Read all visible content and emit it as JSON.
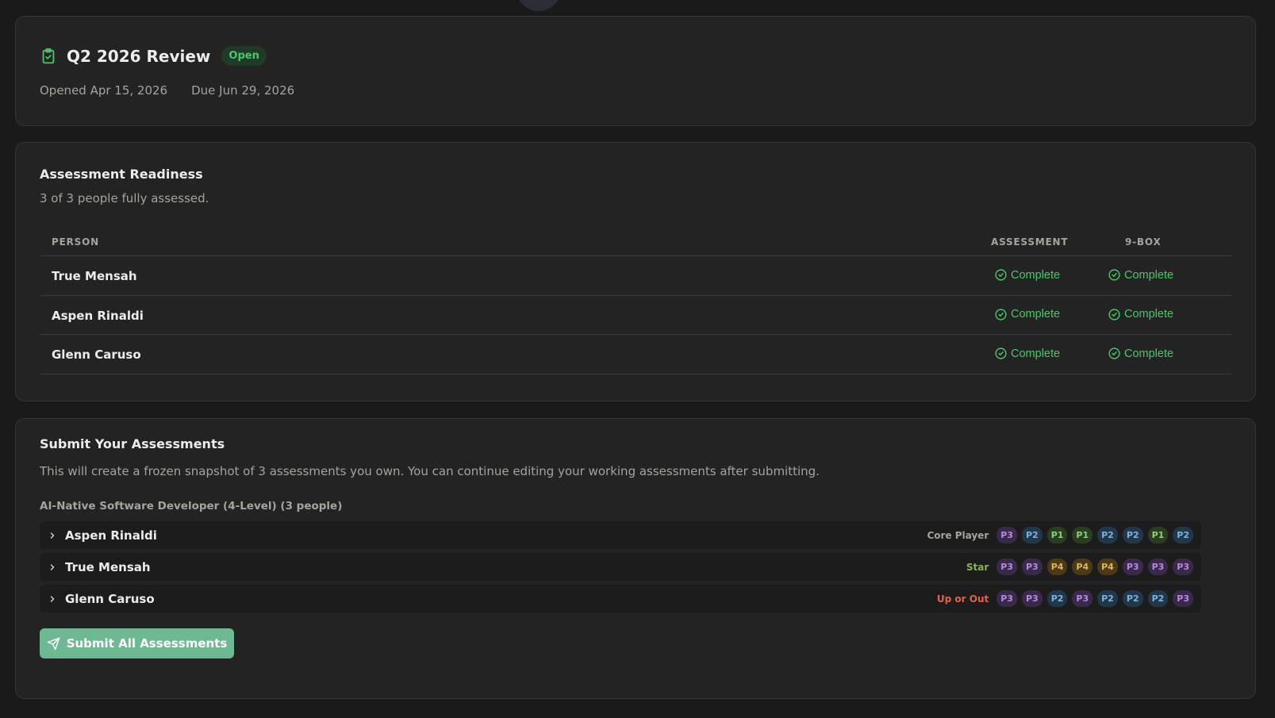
{
  "colors": {
    "accent": "#6fb894",
    "complete": "#4fc46a",
    "open_badge": "#4fc46a",
    "core_player": "#a7a39d",
    "star": "#8bb05a",
    "up_or_out": "#e0644a"
  },
  "review": {
    "title": "Q2 2026 Review",
    "status": "Open",
    "opened": "Opened Apr 15, 2026",
    "due": "Due Jun 29, 2026",
    "icon": "clipboard-check-icon"
  },
  "readiness": {
    "title": "Assessment Readiness",
    "subtitle": "3 of 3 people fully assessed.",
    "columns": {
      "person": "PERSON",
      "assessment": "ASSESSMENT",
      "ninebox": "9-BOX"
    },
    "rows": [
      {
        "name": "True Mensah",
        "assessment": "Complete",
        "ninebox": "Complete"
      },
      {
        "name": "Aspen Rinaldi",
        "assessment": "Complete",
        "ninebox": "Complete"
      },
      {
        "name": "Glenn Caruso",
        "assessment": "Complete",
        "ninebox": "Complete"
      }
    ]
  },
  "submit": {
    "title": "Submit Your Assessments",
    "description": "This will create a frozen snapshot of 3 assessments you own. You can continue editing your working assessments after submitting.",
    "role_header": "AI-Native Software Developer (4-Level) (3 people)",
    "people": [
      {
        "name": "Aspen Rinaldi",
        "category": "Core Player",
        "levels": [
          "P3",
          "P2",
          "P1",
          "P1",
          "P2",
          "P2",
          "P1",
          "P2"
        ]
      },
      {
        "name": "True Mensah",
        "category": "Star",
        "levels": [
          "P3",
          "P3",
          "P4",
          "P4",
          "P4",
          "P3",
          "P3",
          "P3"
        ]
      },
      {
        "name": "Glenn Caruso",
        "category": "Up or Out",
        "levels": [
          "P3",
          "P3",
          "P2",
          "P3",
          "P2",
          "P2",
          "P2",
          "P3"
        ]
      }
    ],
    "button_label": "Submit All Assessments"
  }
}
